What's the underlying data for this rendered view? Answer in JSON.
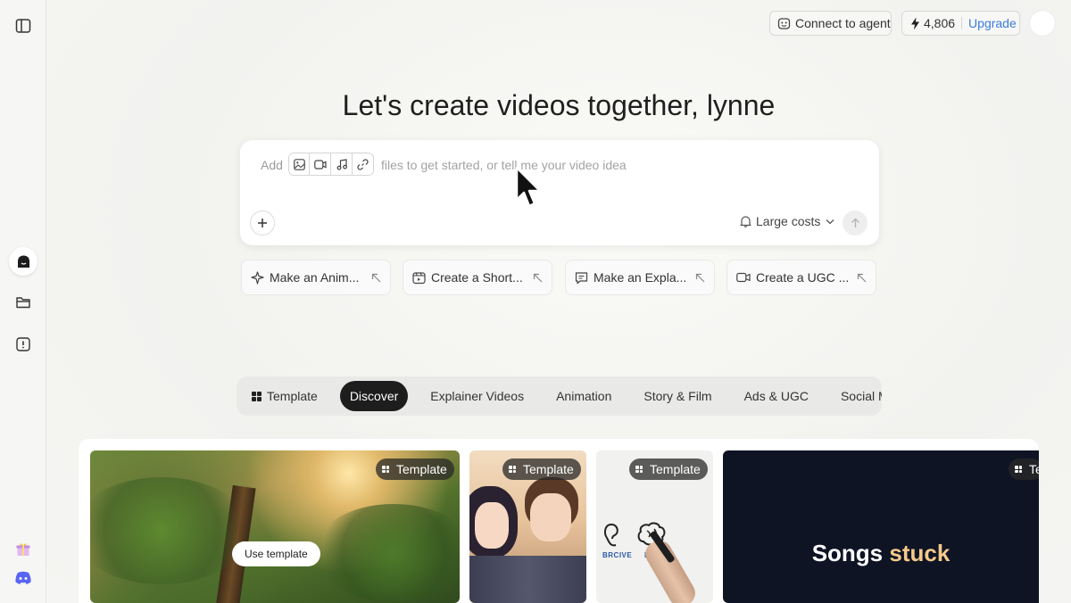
{
  "topbar": {
    "connect_label": "Connect to agent",
    "credits": "4,806",
    "upgrade_label": "Upgrade"
  },
  "hero": {
    "heading": "Let's create videos together, lynne"
  },
  "composer": {
    "add_label": "Add",
    "placeholder": "files to get started, or tell me your video idea",
    "cost_label": "Large costs"
  },
  "quick_actions": [
    {
      "label": "Make an Anim...",
      "icon": "sparkle-icon"
    },
    {
      "label": "Create a Short...",
      "icon": "short-video-icon"
    },
    {
      "label": "Make an Expla...",
      "icon": "chat-icon"
    },
    {
      "label": "Create a UGC ...",
      "icon": "video-camera-icon"
    }
  ],
  "tabs": [
    {
      "label": "Template"
    },
    {
      "label": "Discover"
    },
    {
      "label": "Explainer Videos"
    },
    {
      "label": "Animation"
    },
    {
      "label": "Story & Film"
    },
    {
      "label": "Ads & UGC"
    },
    {
      "label": "Social Med"
    }
  ],
  "gallery": {
    "badge_label": "Template",
    "use_template_label": "Use template",
    "card3_words": [
      "BRCIVE",
      "BR"
    ],
    "card4_title_a": "Songs",
    "card4_title_b": "stuck",
    "card4_badge_partial": "Te"
  },
  "colors": {
    "accent_blue": "#3b7ddd",
    "active_tab_bg": "#1d1d1d",
    "stuck_text": "#f5c98a",
    "card4_bg": "#0e1424"
  }
}
